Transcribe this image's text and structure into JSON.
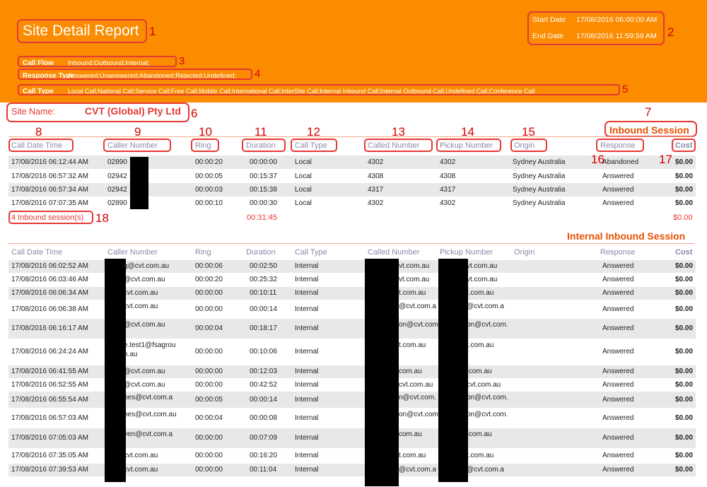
{
  "header": {
    "title": "Site Detail Report",
    "start_date_label": "Start Date",
    "start_date": "17/08/2016 06:00:00 AM",
    "end_date_label": "End Date",
    "end_date": "17/08/2016 11:59:59 AM",
    "call_flow_label": "Call Flow",
    "call_flow": "Inbound;Outbound;Internal;",
    "response_type_label": "Response Type",
    "response_type": "Answered;Unanswered;Abandoned;Rejected;Undefined;",
    "call_type_label": "Call Type",
    "call_type": "Local Call;National Call;Service Call;Free Call;Mobile Call;International Call;InterSite Call;Internal Inbound Call;Internal Outbound Call;Undefined Call;Conference Call"
  },
  "site": {
    "label": "Site Name:",
    "value": "CVT (Global) Pty Ltd"
  },
  "annotations": {
    "n1": "1",
    "n2": "2",
    "n3": "3",
    "n4": "4",
    "n5": "5",
    "n6": "6",
    "n7": "7",
    "n8": "8",
    "n9": "9",
    "n10": "10",
    "n11": "11",
    "n12": "12",
    "n13": "13",
    "n14": "14",
    "n15": "15",
    "n16": "16",
    "n17": "17",
    "n18": "18"
  },
  "columns": {
    "date": "Call Date Time",
    "caller": "Caller Number",
    "ring": "Ring",
    "duration": "Duration",
    "call_type": "Call Type",
    "called": "Called Number",
    "pickup": "Pickup Number",
    "origin": "Origin",
    "response": "Response",
    "cost": "Cost"
  },
  "inbound": {
    "title": "Inbound Session",
    "rows": [
      {
        "date": "17/08/2016 06:12:44 AM",
        "caller": "02890",
        "ring": "00:00:20",
        "duration": "00:00:00",
        "type": "Local",
        "called": "4302",
        "pickup": "4302",
        "origin": "Sydney Australia",
        "response": "Abandoned",
        "cost": "$0.00"
      },
      {
        "date": "17/08/2016 06:57:32 AM",
        "caller": "02942",
        "ring": "00:00:05",
        "duration": "00:15:37",
        "type": "Local",
        "called": "4308",
        "pickup": "4308",
        "origin": "Sydney Australia",
        "response": "Answered",
        "cost": "$0.00"
      },
      {
        "date": "17/08/2016 06:57:34 AM",
        "caller": "02942",
        "ring": "00:00:03",
        "duration": "00:15:38",
        "type": "Local",
        "called": "4317",
        "pickup": "4317",
        "origin": "Sydney Australia",
        "response": "Answered",
        "cost": "$0.00"
      },
      {
        "date": "17/08/2016 07:07:35 AM",
        "caller": "02890",
        "ring": "00:00:10",
        "duration": "00:00:30",
        "type": "Local",
        "called": "4302",
        "pickup": "4302",
        "origin": "Sydney Australia",
        "response": "Answered",
        "cost": "$0.00"
      }
    ],
    "summary_count": "4 Inbound session(s)",
    "summary_duration": "00:31:45",
    "summary_cost": "$0.00"
  },
  "internal": {
    "title": "Internal Inbound Session",
    "rows": [
      {
        "date": "17/08/2016 06:02:52 AM",
        "caller": "g@cvt.com.au",
        "ring": "00:00:06",
        "duration": "00:02:50",
        "type": "Internal",
        "called": "vt.com.au",
        "pickup": "vt.com.au",
        "response": "Answered",
        "cost": "$0.00"
      },
      {
        "date": "17/08/2016 06:03:46 AM",
        "caller": "@cvt.com.au",
        "ring": "00:00:20",
        "duration": "00:25:32",
        "type": "Internal",
        "called": "vt.com.au",
        "pickup": "vt.com.au",
        "response": "Answered",
        "cost": "$0.00"
      },
      {
        "date": "17/08/2016 06:06:34 AM",
        "caller": "cvt.com.au",
        "ring": "00:00:00",
        "duration": "00:10:11",
        "type": "Internal",
        "called": "t.com.au",
        "pickup": "t.com.au",
        "response": "Answered",
        "cost": "$0.00"
      },
      {
        "date": "17/08/2016 06:06:38 AM",
        "caller": "cvt.com.au",
        "ring": "00:00:00",
        "duration": "00:00:14",
        "type": "Internal",
        "called": "@cvt.com.a",
        "pickup": "@cvt.com.a",
        "response": "Answered",
        "cost": "$0.00"
      },
      {
        "date": "17/08/2016 06:16:17 AM",
        "caller": "@cvt.com.au",
        "ring": "00:00:04",
        "duration": "00:18:17",
        "type": "Internal",
        "called": "on@cvt.com.",
        "pickup": "on@cvt.com.",
        "response": "Answered",
        "cost": "$0.00"
      },
      {
        "date": "17/08/2016 06:24:24 AM",
        "caller": "e.test1@fsagrou",
        "caller2": "n.au",
        "ring": "00:00:00",
        "duration": "00:10:06",
        "type": "Internal",
        "called": "t.com.au",
        "pickup": "t.com.au",
        "response": "Answered",
        "cost": "$0.00"
      },
      {
        "date": "17/08/2016 06:41:55 AM",
        "caller": "@cvt.com.au",
        "ring": "00:00:00",
        "duration": "00:12:03",
        "type": "Internal",
        "called": "com.au",
        "pickup": ".com.au",
        "response": "Answered",
        "cost": "$0.00"
      },
      {
        "date": "17/08/2016 06:52:55 AM",
        "caller": "@cvt.com.au",
        "ring": "00:00:00",
        "duration": "00:42:52",
        "type": "Internal",
        "called": "cvt.com.au",
        "pickup": "cvt.com.au",
        "response": "Answered",
        "cost": "$0.00"
      },
      {
        "date": "17/08/2016 06:55:54 AM",
        "caller": "nes@cvt.com.a",
        "ring": "00:00:05",
        "duration": "00:00:14",
        "type": "Internal",
        "called": "n@cvt.com.",
        "pickup": "on@cvt.com.",
        "response": "Answered",
        "cost": "$0.00"
      },
      {
        "date": "17/08/2016 06:57:03 AM",
        "caller": "nes@cvt.com.au",
        "ring": "00:00:04",
        "duration": "00:00:08",
        "type": "Internal",
        "called": "on@cvt.com.",
        "pickup": "on@cvt.com.",
        "response": "Answered",
        "cost": "$0.00"
      },
      {
        "date": "17/08/2016 07:05:03 AM",
        "caller": "yen@cvt.com.a",
        "ring": "00:00:00",
        "duration": "00:07:09",
        "type": "Internal",
        "called": "com.au",
        "pickup": ".com.au",
        "response": "Answered",
        "cost": "$0.00"
      },
      {
        "date": "17/08/2016 07:35:05 AM",
        "caller": "cvt.com.au",
        "ring": "00:00:00",
        "duration": "00:16:20",
        "type": "Internal",
        "called": "t.com.au",
        "pickup": "t.com.au",
        "response": "Answered",
        "cost": "$0.00"
      },
      {
        "date": "17/08/2016 07:39:53 AM",
        "caller": "cvt.com.au",
        "ring": "00:00:00",
        "duration": "00:11:04",
        "type": "Internal",
        "called": "@cvt.com.a",
        "pickup": "@cvt.com.a",
        "response": "Answered",
        "cost": "$0.00"
      }
    ]
  }
}
